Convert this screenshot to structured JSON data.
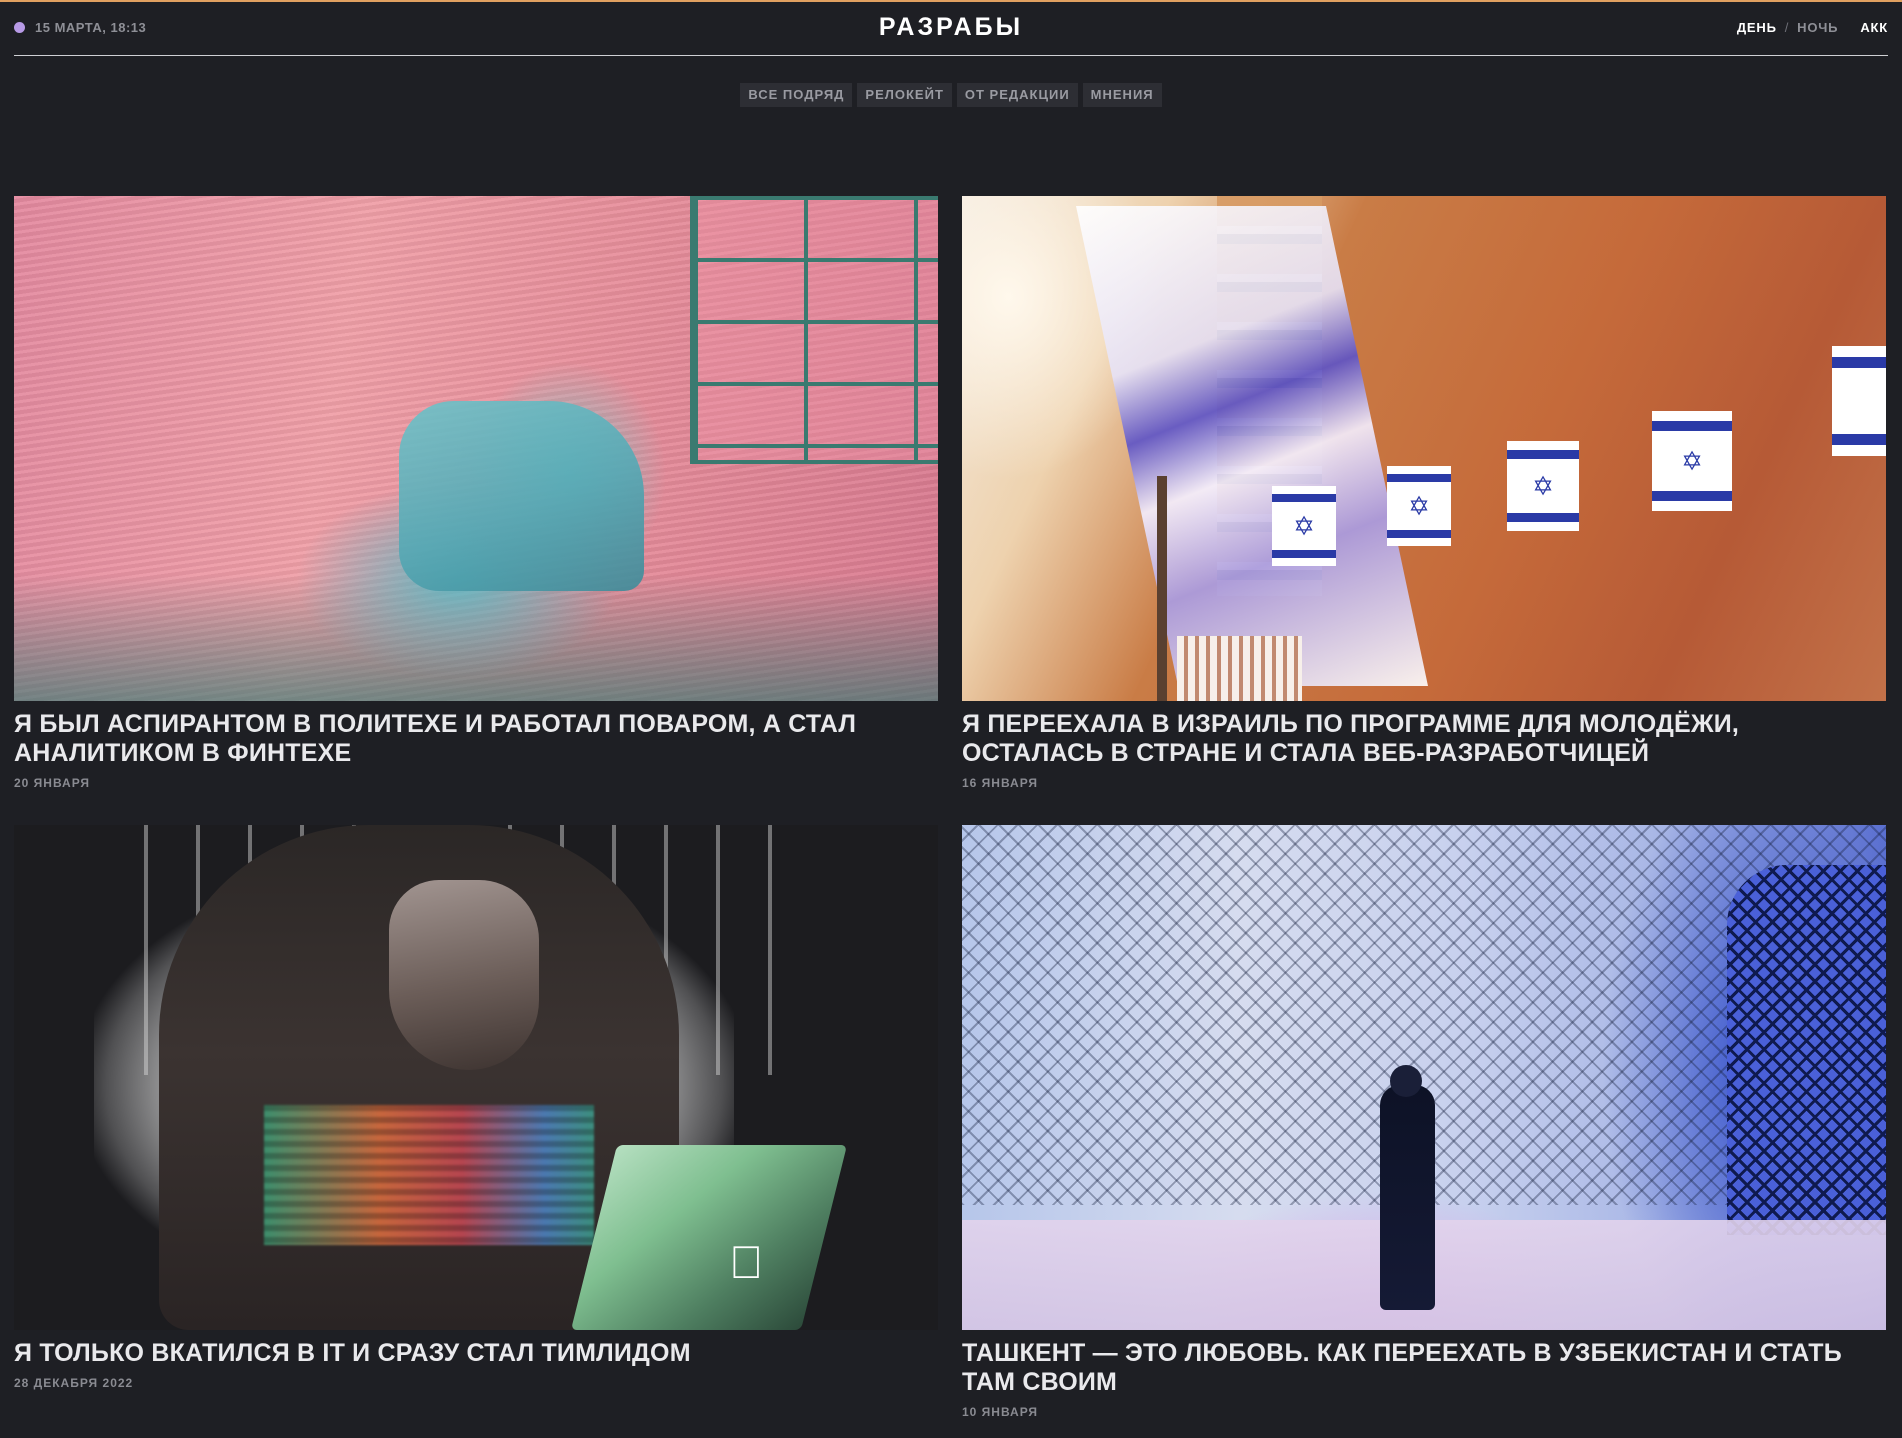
{
  "header": {
    "date": "15 МАРТА, 18:13",
    "logo": "РАЗРАБЫ",
    "theme_day": "ДЕНЬ",
    "theme_separator": "/",
    "theme_night": "НОЧЬ",
    "account": "АКК",
    "dot_color": "#b79ae6",
    "topline_color": "#e0a060"
  },
  "tags": [
    {
      "label": "ВСЕ ПОДРЯД"
    },
    {
      "label": "РЕЛОКЕЙТ"
    },
    {
      "label": "ОТ РЕДАКЦИИ"
    },
    {
      "label": "МНЕНИЯ"
    }
  ],
  "articles": [
    {
      "title": "Я БЫЛ АСПИРАНТОМ В ПОЛИТЕХЕ И РАБОТАЛ ПОВАРОМ, А СТАЛ АНАЛИТИКОМ В ФИНТЕХЕ",
      "date": "20 ЯНВАРЯ"
    },
    {
      "title": "Я ПЕРЕЕХАЛА В ИЗРАИЛЬ ПО ПРОГРАММЕ ДЛЯ МОЛОДЁЖИ, ОСТАЛАСЬ В СТРАНЕ И СТАЛА ВЕБ-РАЗРАБОТЧИЦЕЙ",
      "date": "16 ЯНВАРЯ"
    },
    {
      "title": "Я ТОЛЬКО ВКАТИЛСЯ В IT И СРАЗУ СТАЛ ТИМЛИДОМ",
      "date": "28 ДЕКАБРЯ 2022"
    },
    {
      "title": "ТАШКЕНТ — ЭТО ЛЮБОВЬ. КАК ПЕРЕЕХАТЬ В УЗБЕКИСТАН И СТАТЬ ТАМ СВОИМ",
      "date": "10 ЯНВАРЯ"
    }
  ],
  "icons": {
    "star_of_david": "✡",
    "apple_logo": ""
  }
}
